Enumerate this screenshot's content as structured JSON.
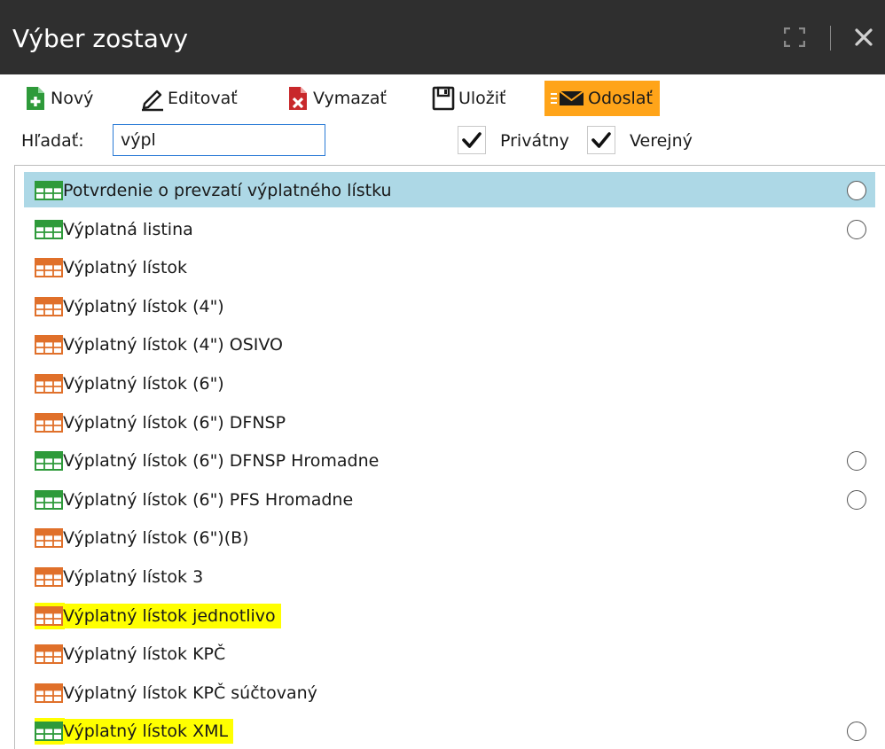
{
  "window": {
    "title": "Výber zostavy",
    "maximize_icon": "maximize-icon",
    "close_icon": "close-icon",
    "titlebar_color": "#2f2f2f"
  },
  "toolbar": {
    "new_label": "Nový",
    "edit_label": "Editovať",
    "delete_label": "Vymazať",
    "save_label": "Uložiť",
    "send_label": "Odoslať",
    "send_bg_color": "#ffa419"
  },
  "search": {
    "label": "Hľadať:",
    "value": "výpl"
  },
  "filters": {
    "private_label": "Privátny",
    "private_checked": true,
    "public_label": "Verejný",
    "public_checked": true
  },
  "colors": {
    "selected_row": "#add8e6",
    "highlight": "#ffff00",
    "icon_green": "#2e9a3a",
    "icon_orange": "#e0702a"
  },
  "list": {
    "items": [
      {
        "name": "Potvrdenie o prevzatí výplatného lístku",
        "icon": "green-table-icon",
        "radio": true,
        "selected": true,
        "highlighted": false
      },
      {
        "name": "Výplatná listina",
        "icon": "green-table-icon",
        "radio": true,
        "selected": false,
        "highlighted": false
      },
      {
        "name": "Výplatný lístok",
        "icon": "orange-table-icon",
        "radio": false,
        "selected": false,
        "highlighted": false
      },
      {
        "name": "Výplatný lístok (4\")",
        "icon": "orange-table-icon",
        "radio": false,
        "selected": false,
        "highlighted": false
      },
      {
        "name": "Výplatný lístok (4\") OSIVO",
        "icon": "orange-table-icon",
        "radio": false,
        "selected": false,
        "highlighted": false
      },
      {
        "name": "Výplatný lístok (6\")",
        "icon": "orange-table-icon",
        "radio": false,
        "selected": false,
        "highlighted": false
      },
      {
        "name": "Výplatný lístok (6\") DFNSP",
        "icon": "orange-table-icon",
        "radio": false,
        "selected": false,
        "highlighted": false
      },
      {
        "name": "Výplatný lístok (6\") DFNSP Hromadne",
        "icon": "green-table-icon",
        "radio": true,
        "selected": false,
        "highlighted": false
      },
      {
        "name": "Výplatný lístok (6\") PFS Hromadne",
        "icon": "green-table-icon",
        "radio": true,
        "selected": false,
        "highlighted": false
      },
      {
        "name": "Výplatný lístok (6\")(B)",
        "icon": "orange-table-icon",
        "radio": false,
        "selected": false,
        "highlighted": false
      },
      {
        "name": "Výplatný lístok 3",
        "icon": "orange-table-icon",
        "radio": false,
        "selected": false,
        "highlighted": false
      },
      {
        "name": "Výplatný lístok jednotlivo",
        "icon": "orange-table-icon",
        "radio": false,
        "selected": false,
        "highlighted": true
      },
      {
        "name": "Výplatný lístok KPČ",
        "icon": "orange-table-icon",
        "radio": false,
        "selected": false,
        "highlighted": false
      },
      {
        "name": "Výplatný lístok KPČ súčtovaný",
        "icon": "orange-table-icon",
        "radio": false,
        "selected": false,
        "highlighted": false
      },
      {
        "name": "Výplatný lístok XML",
        "icon": "green-table-icon",
        "radio": true,
        "selected": false,
        "highlighted": true
      }
    ]
  }
}
